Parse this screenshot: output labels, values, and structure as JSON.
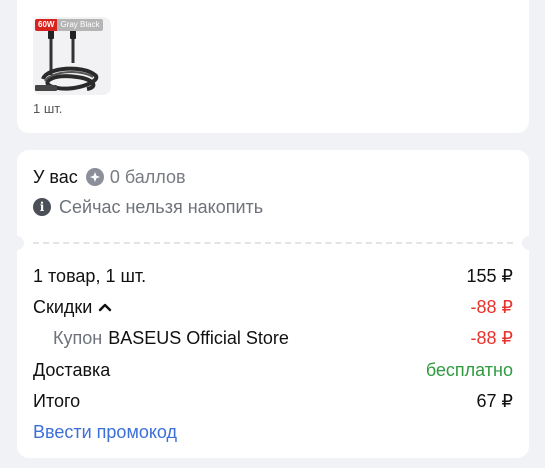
{
  "product": {
    "badge_power": "60W",
    "badge_color": "Gray Black",
    "image_icon": "usb-c-cable-image",
    "quantity": "1 шт."
  },
  "points": {
    "prefix": "У вас",
    "value": "0 баллов",
    "icon": "points-coin-icon",
    "notice": "Сейчас нельзя накопить",
    "notice_icon": "info-icon"
  },
  "summary": {
    "items_label": "1 товар, 1 шт.",
    "items_value": "155 ₽",
    "discounts_label": "Скидки",
    "discounts_value": "-88 ₽",
    "coupon_label_prefix": "Купон",
    "coupon_label_store": "BASEUS Official Store",
    "coupon_value": "-88 ₽",
    "delivery_label": "Доставка",
    "delivery_value": "бесплатно",
    "total_label": "Итого",
    "total_value": "67 ₽"
  },
  "promo_link": "Ввести промокод",
  "colors": {
    "discount_red": "#e8322c",
    "free_green": "#2e9b3f",
    "link_blue": "#3c6fd8"
  }
}
